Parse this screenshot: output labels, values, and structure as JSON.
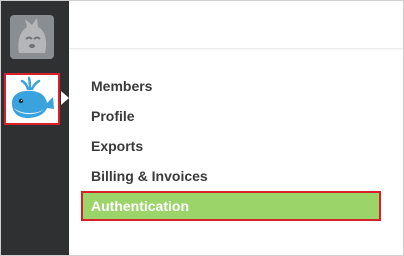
{
  "sidebar": {
    "workspaces": [
      {
        "icon": "fox-avatar-icon",
        "active": false
      },
      {
        "icon": "whale-avatar-icon",
        "active": true
      }
    ]
  },
  "menu": {
    "items": [
      {
        "label": "Members"
      },
      {
        "label": "Profile"
      },
      {
        "label": "Exports"
      },
      {
        "label": "Billing & Invoices"
      },
      {
        "label": "Authentication",
        "active": true
      }
    ]
  },
  "colors": {
    "sidebar_bg": "#2f3031",
    "active_item_bg": "#9bd56a",
    "highlight_border": "#d8202a",
    "text": "#3a3a3a"
  }
}
